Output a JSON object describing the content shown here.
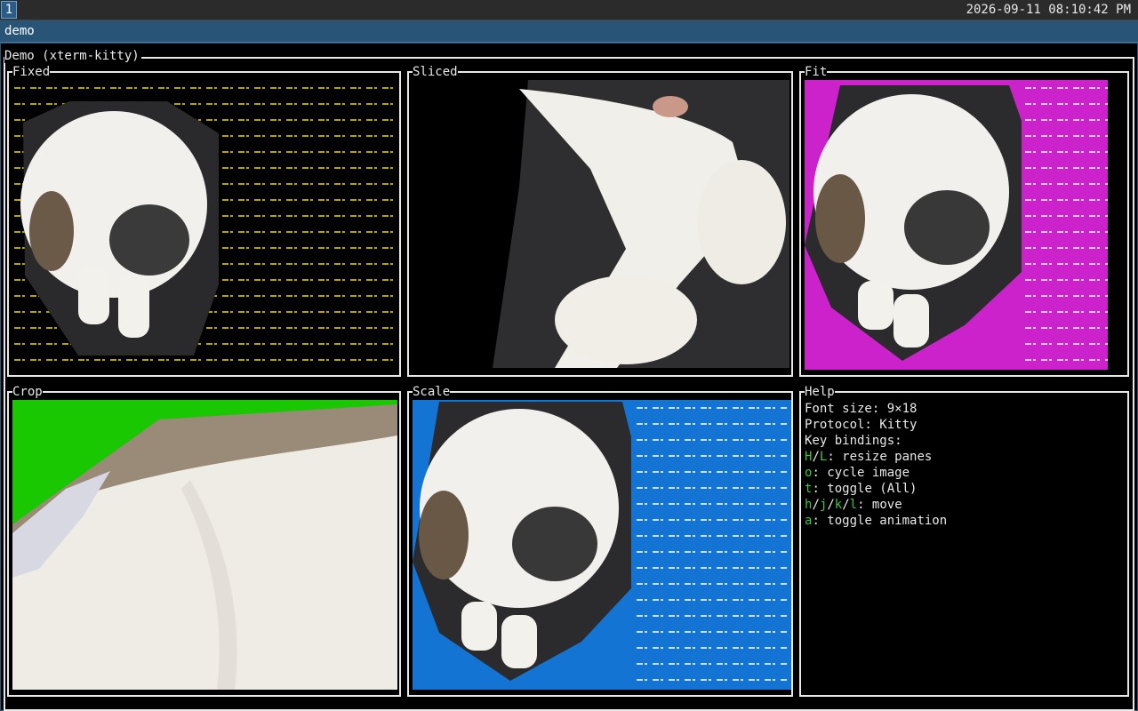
{
  "topbar": {
    "workspace": "1",
    "datetime": "2026-09-11 08:10:42 PM"
  },
  "window": {
    "title": "demo"
  },
  "demo": {
    "title": "Demo (xterm-kitty)"
  },
  "panes": {
    "fixed": {
      "label": "Fixed",
      "fill_color": "#d6c400"
    },
    "sliced": {
      "label": "Sliced"
    },
    "fit": {
      "label": "Fit",
      "bg_color": "#cc22cc",
      "fill_color": "#cc22cc"
    },
    "crop": {
      "label": "Crop",
      "bg_color": "#19c800"
    },
    "scale": {
      "label": "Scale",
      "bg_color": "#1474d4",
      "fill_color": "#1474d4"
    },
    "help": {
      "label": "Help"
    }
  },
  "help": {
    "font_size": "Font size: 9×18",
    "protocol": "Protocol: Kitty",
    "key_bindings_title": "Key bindings:",
    "bindings": {
      "resize": {
        "k1": "H",
        "sep1": "/",
        "k2": "L",
        "desc": ": resize panes"
      },
      "cycle": {
        "k1": "o",
        "desc": ": cycle image"
      },
      "toggle": {
        "k1": "t",
        "desc": ": toggle (All)"
      },
      "move": {
        "k1": "h",
        "s1": "/",
        "k2": "j",
        "s2": "/",
        "k3": "k",
        "s3": "/",
        "k4": "l",
        "desc": ": move"
      },
      "animation": {
        "k1": "a",
        "desc": ": toggle animation"
      }
    }
  },
  "colors": {
    "accent_green": "#3ec43e",
    "titlebar": "#285577"
  }
}
